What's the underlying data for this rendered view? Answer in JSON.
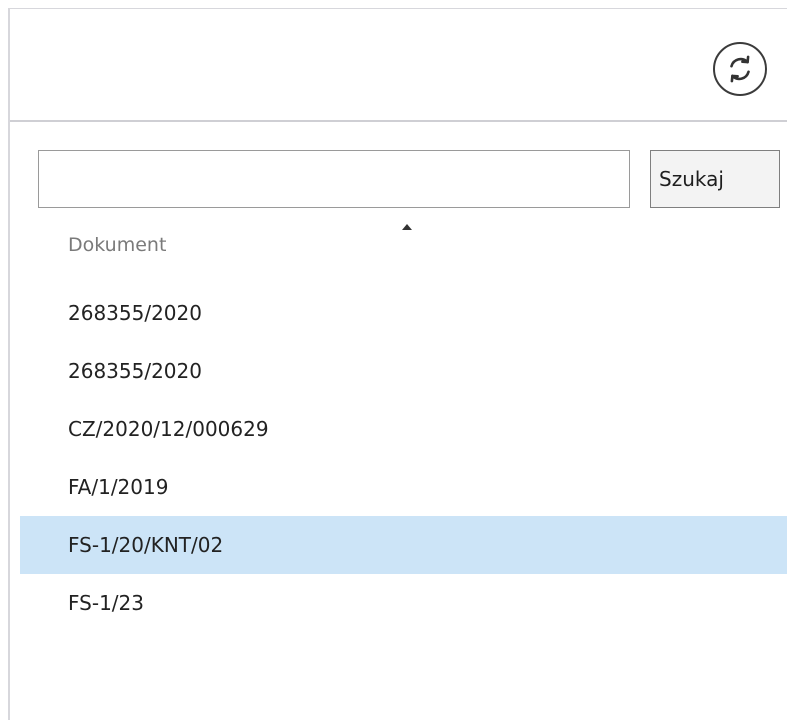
{
  "toolbar": {
    "refresh_icon": "refresh-icon"
  },
  "search": {
    "value": "",
    "placeholder": "",
    "button_label": "Szukaj"
  },
  "table": {
    "column_header": "Dokument",
    "sort_direction": "ascending",
    "rows": [
      {
        "label": "268355/2020",
        "selected": false
      },
      {
        "label": "268355/2020",
        "selected": false
      },
      {
        "label": "CZ/2020/12/000629",
        "selected": false
      },
      {
        "label": "FA/1/2019",
        "selected": false
      },
      {
        "label": "FS-1/20/KNT/02",
        "selected": true
      },
      {
        "label": "FS-1/23",
        "selected": false
      }
    ]
  },
  "colors": {
    "selection_background": "#cce4f7",
    "border": "#d7d7dc",
    "header_text": "#7a7a7a"
  }
}
